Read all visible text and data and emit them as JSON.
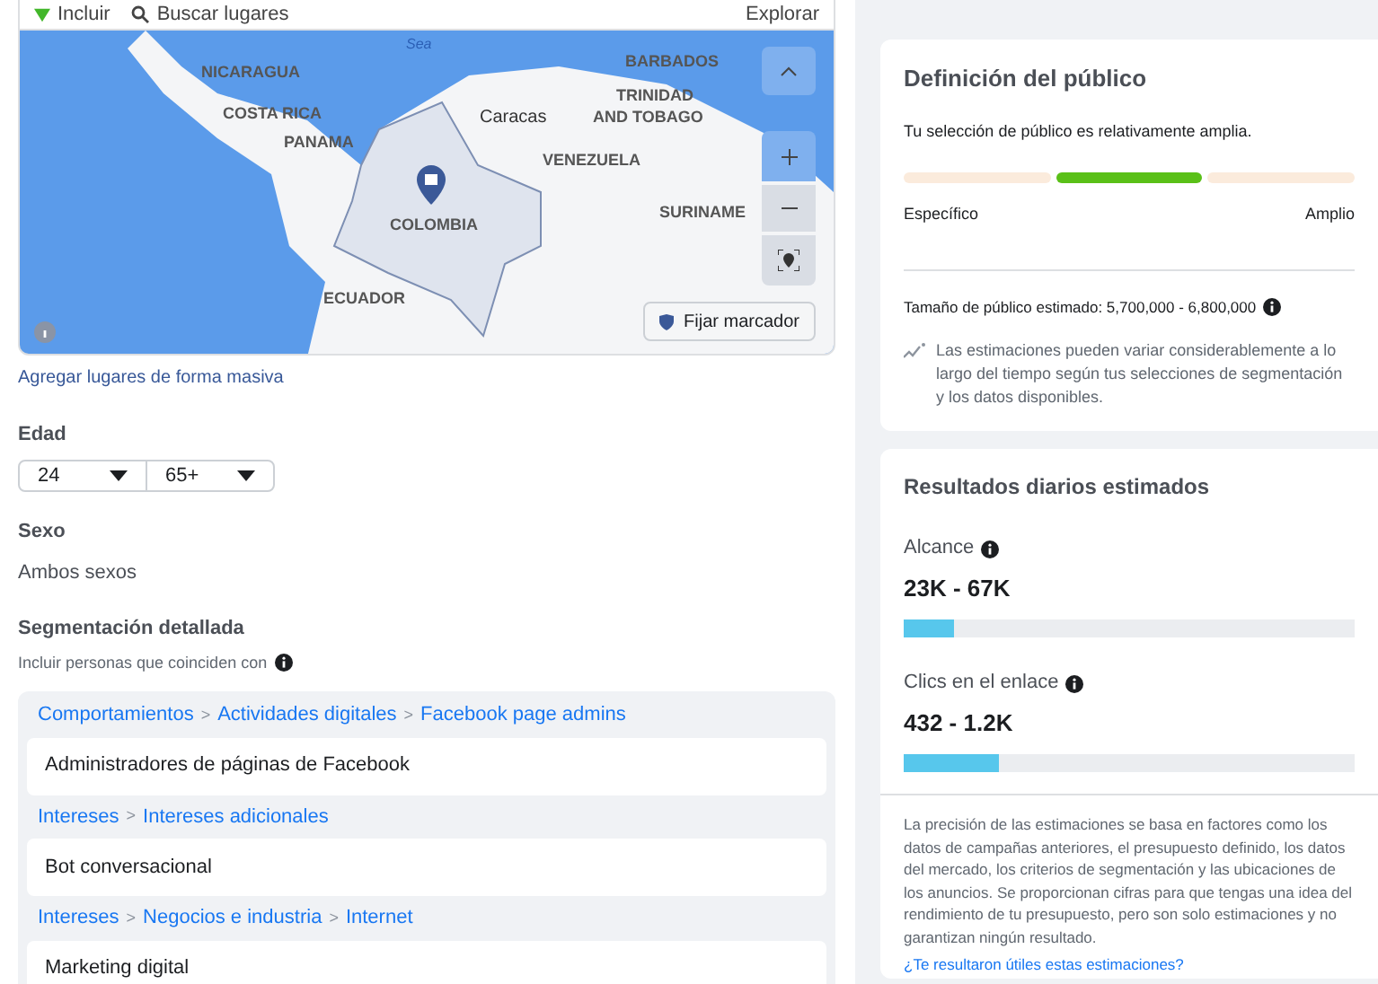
{
  "location_bar": {
    "mode": "Incluir",
    "search_placeholder": "Buscar lugares",
    "explore": "Explorar"
  },
  "map": {
    "labels": [
      {
        "text": "Sea",
        "kind": "water"
      },
      {
        "text": "NICARAGUA",
        "kind": "country"
      },
      {
        "text": "COSTA RICA",
        "kind": "country"
      },
      {
        "text": "PANAMA",
        "kind": "country"
      },
      {
        "text": "Caracas",
        "kind": "city"
      },
      {
        "text": "BARBADOS",
        "kind": "country"
      },
      {
        "text": "TRINIDAD",
        "kind": "country"
      },
      {
        "text": "AND TOBAGO",
        "kind": "country"
      },
      {
        "text": "VENEZUELA",
        "kind": "country"
      },
      {
        "text": "COLOMBIA",
        "kind": "country"
      },
      {
        "text": "SURINAME",
        "kind": "country"
      },
      {
        "text": "ECUADOR",
        "kind": "country"
      }
    ],
    "pin_button": "Fijar marcador"
  },
  "bulk_link": "Agregar lugares de forma masiva",
  "age": {
    "label": "Edad",
    "min": "24",
    "max": "65+"
  },
  "gender": {
    "label": "Sexo",
    "value": "Ambos sexos"
  },
  "detailed": {
    "label": "Segmentación detallada",
    "hint": "Incluir personas que coinciden con",
    "separator": ">",
    "groups": [
      {
        "path": [
          "Comportamientos",
          "Actividades digitales",
          "Facebook page admins"
        ],
        "item": "Administradores de páginas de Facebook"
      },
      {
        "path": [
          "Intereses",
          "Intereses adicionales"
        ],
        "item": "Bot conversacional"
      },
      {
        "path": [
          "Intereses",
          "Negocios e industria",
          "Internet"
        ],
        "item": "Marketing digital"
      }
    ]
  },
  "audience": {
    "title": "Definición del público",
    "summary": "Tu selección de público es relativamente amplia.",
    "segments": [
      {
        "selected": false
      },
      {
        "selected": true
      },
      {
        "selected": false
      }
    ],
    "left_label": "Específico",
    "right_label": "Amplio",
    "size": "Tamaño de público estimado: 5,700,000 - 6,800,000",
    "note": "Las estimaciones pueden variar considerablemente a lo largo del tiempo según tus selecciones de segmentación y los datos disponibles."
  },
  "results": {
    "title": "Resultados diarios estimados",
    "metrics": [
      {
        "label": "Alcance",
        "value": "23K - 67K",
        "level": 0.11
      },
      {
        "label": "Clics en el enlace",
        "value": "432 - 1.2K",
        "level": 0.21
      }
    ],
    "disclaimer": "La precisión de las estimaciones se basa en factores como los datos de campañas anteriores, el presupuesto definido, los datos del mercado, los criterios de segmentación y las ubicaciones de los anuncios. Se proporcionan cifras para que tengas una idea del rendimiento de tu presupuesto, pero son solo estimaciones y no garantizan ningún resultado.",
    "feedback_link": "¿Te resultaron útiles estas estimaciones?"
  }
}
